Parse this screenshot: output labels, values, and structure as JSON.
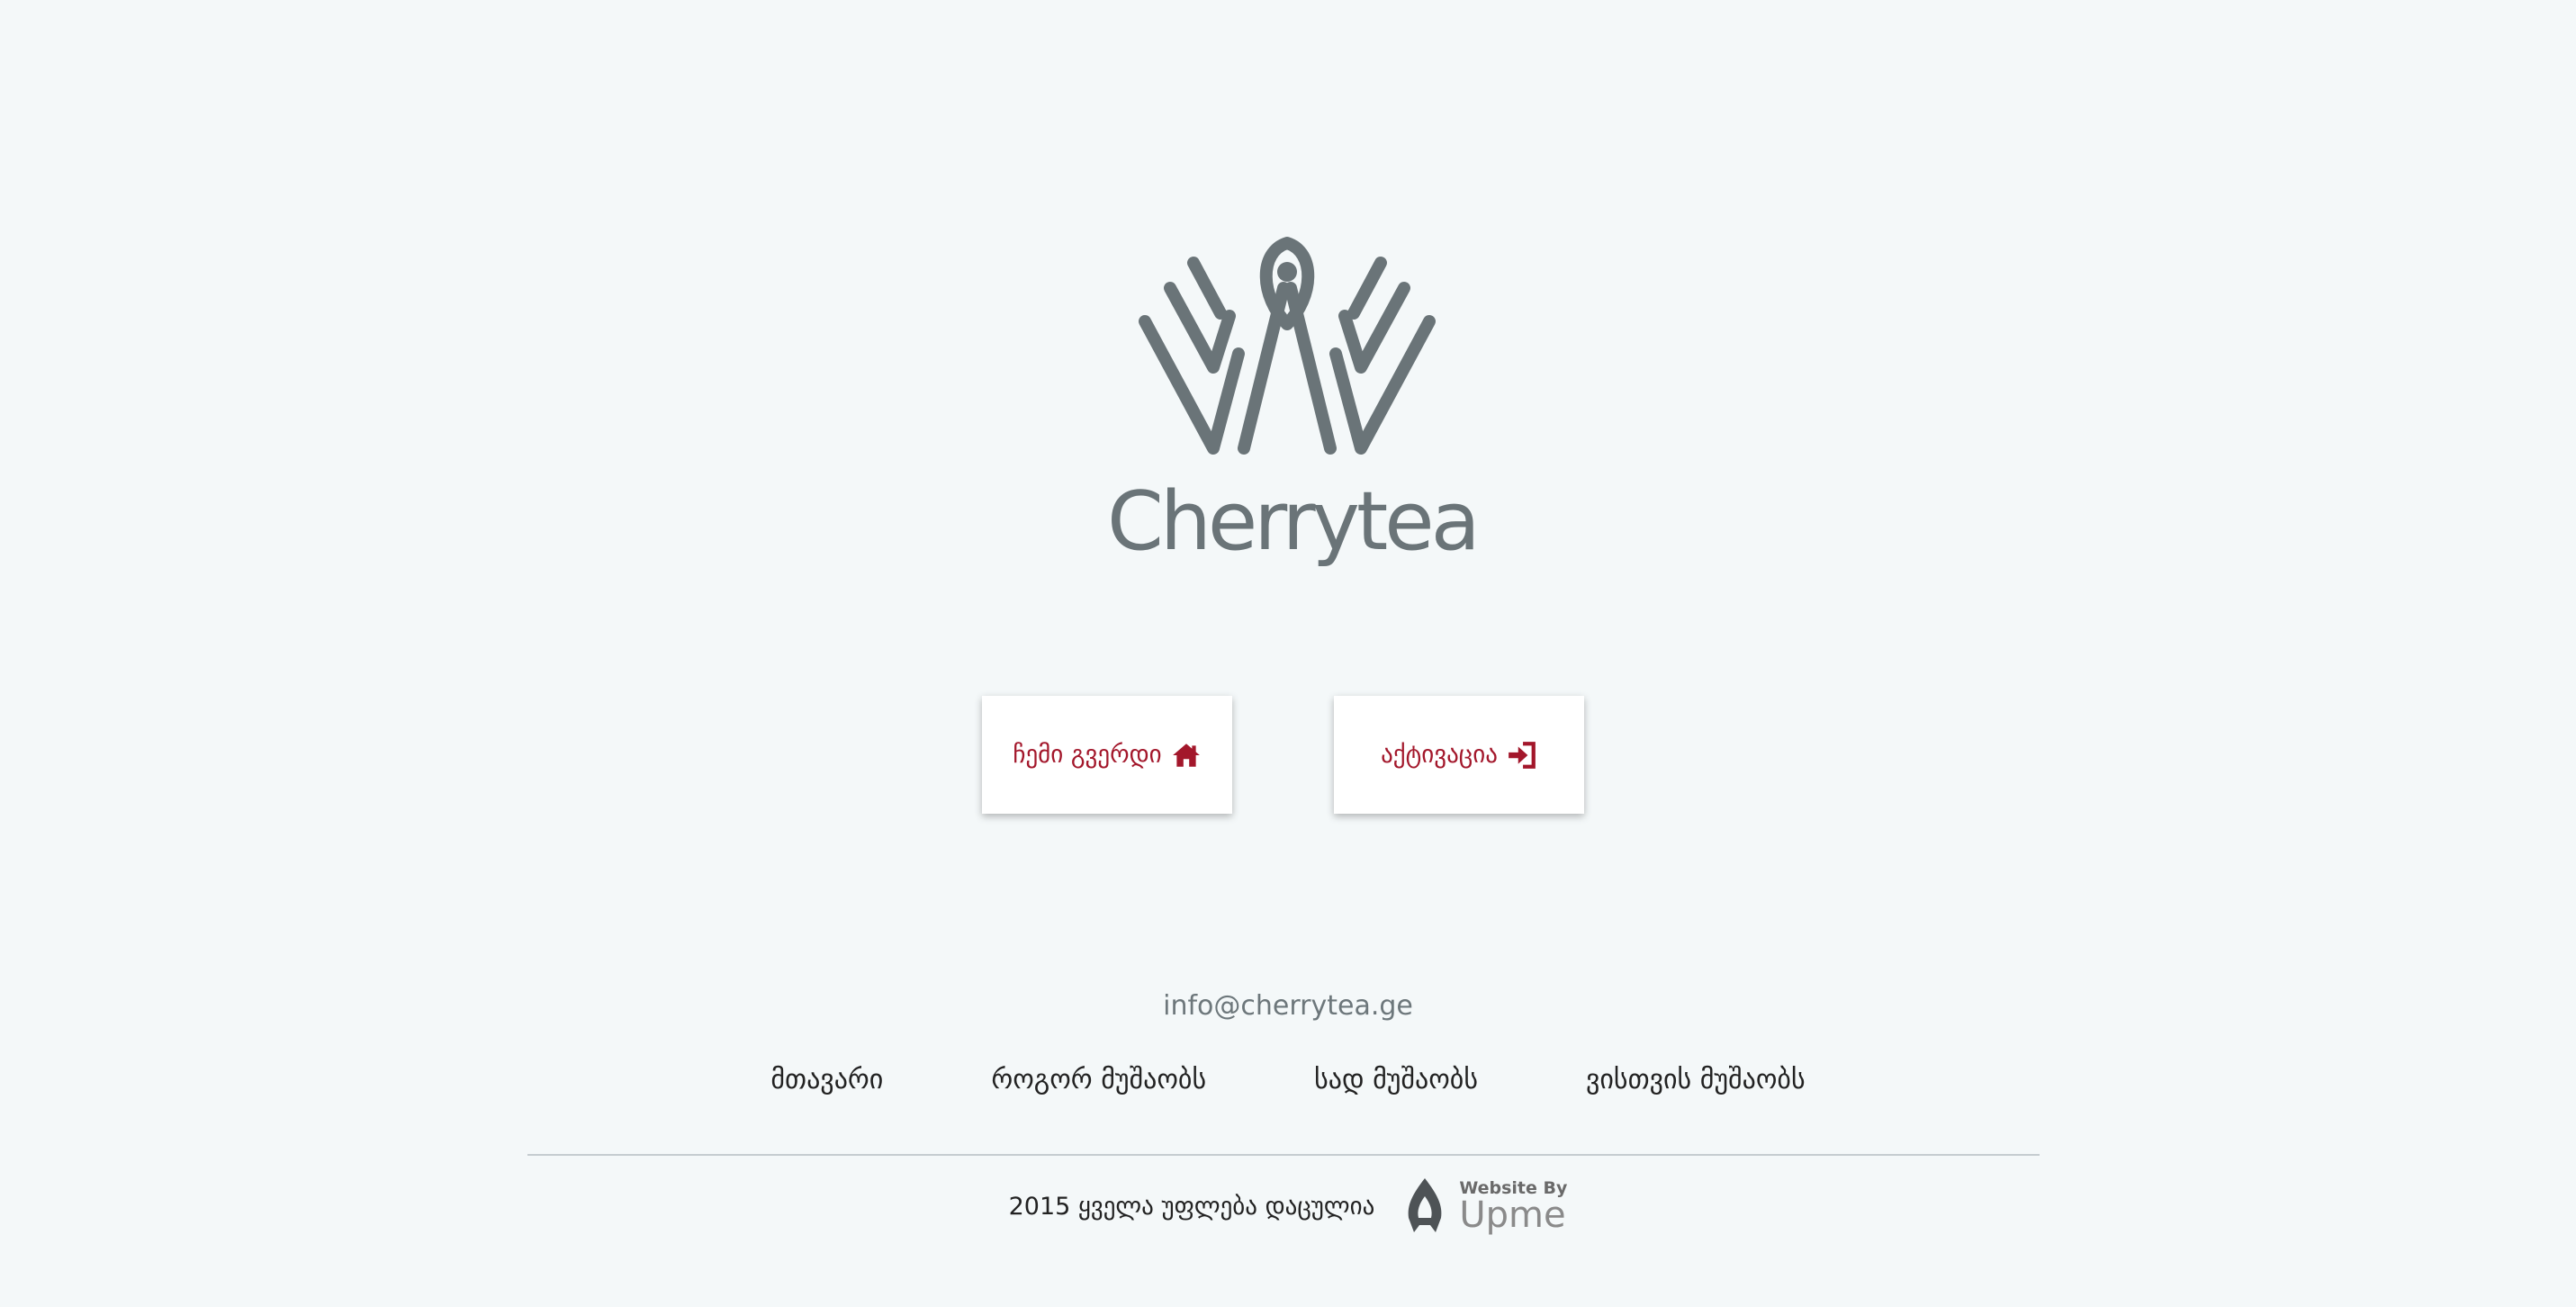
{
  "brand": {
    "name": "Cherrytea",
    "color": "#6a7478",
    "logo_icon": "cherrytea-logo-icon"
  },
  "buttons": {
    "home_label": "ჩემი გვერდი",
    "home_icon": "home-icon",
    "activate_label": "აქტივაცია",
    "activate_icon": "sign-in-icon",
    "accent_color": "#a3172b"
  },
  "contact": {
    "email": "info@cherrytea.ge"
  },
  "nav": {
    "items": [
      {
        "label": "მთავარი"
      },
      {
        "label": "როგორ მუშაობს"
      },
      {
        "label": "სად მუშაობს"
      },
      {
        "label": "ვისთვის მუშაობს"
      }
    ]
  },
  "footer": {
    "copyright": "2015 ყველა უფლება დაცულია",
    "credit_small": "Website By",
    "credit_brand": "Upme"
  }
}
